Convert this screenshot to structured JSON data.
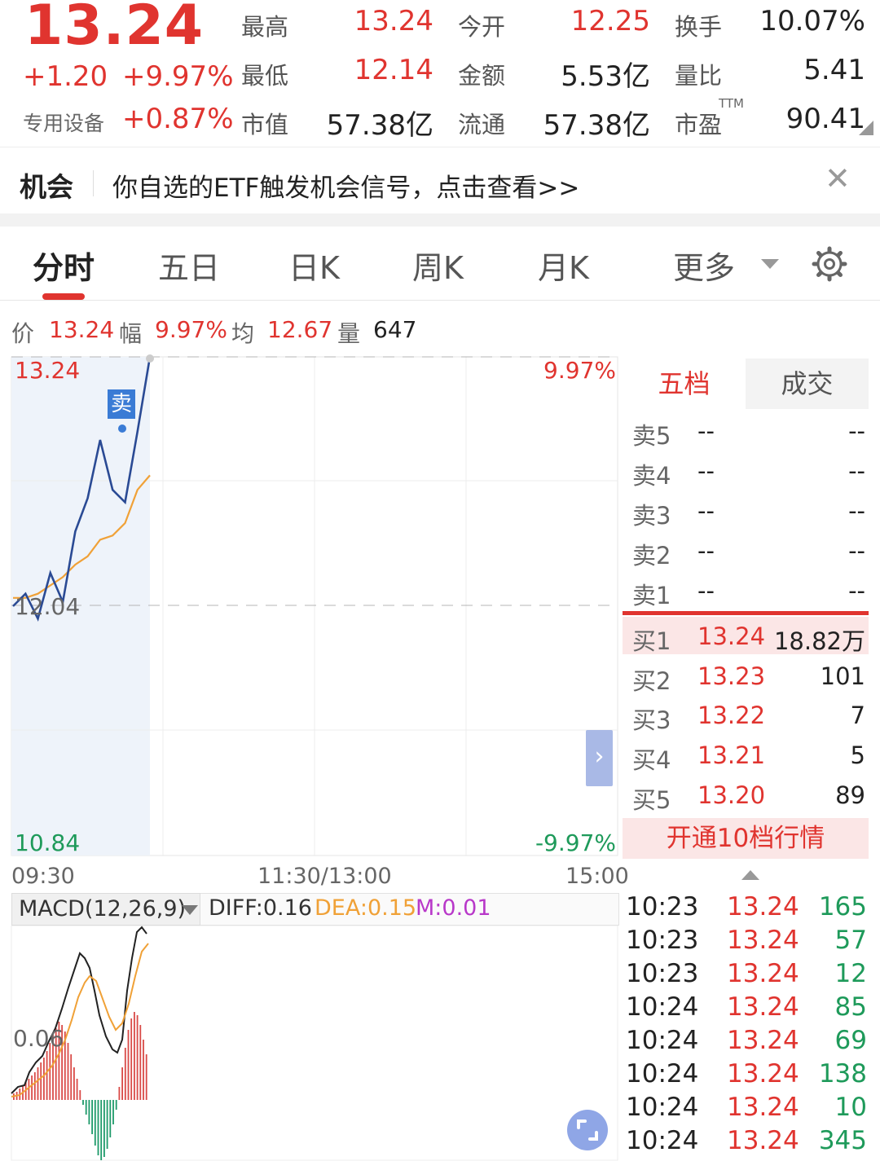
{
  "quote": {
    "price": "13.24",
    "change": "+1.20",
    "change_pct": "+9.97%",
    "sector_name": "专用设备",
    "sector_change": "+0.87%",
    "rows": [
      {
        "l1": "最高",
        "v1": "13.24",
        "l2": "今开",
        "v2": "12.25",
        "l3": "换手",
        "v3": "10.07%"
      },
      {
        "l1": "最低",
        "v1": "12.14",
        "l2": "金额",
        "v2": "5.53亿",
        "l3": "量比",
        "v3": "5.41"
      },
      {
        "l1": "市值",
        "v1": "57.38亿",
        "l2": "流通",
        "v2": "57.38亿",
        "l3": "市盈",
        "v3": "90.41"
      }
    ],
    "ttm": "TTM"
  },
  "opportunity": {
    "label": "机会",
    "text": "你自选的ETF触发机会信号，点击查看>>",
    "close_glyph": "✕"
  },
  "tabs": [
    "分时",
    "五日",
    "日K",
    "周K",
    "月K",
    "更多"
  ],
  "info": {
    "price_label": "价",
    "price": "13.24",
    "amp_label": "幅",
    "amp": "9.97%",
    "avg_label": "均",
    "avg": "12.67",
    "vol_label": "量",
    "vol": "647"
  },
  "chart": {
    "y_top": "13.24",
    "y_mid": "12.04",
    "y_bottom": "10.84",
    "pct_top": "9.97%",
    "pct_bottom": "-9.97%",
    "sell_marker": "卖",
    "times": [
      "09:30",
      "11:30/13:00",
      "15:00"
    ],
    "expand_glyph": "›"
  },
  "chart_data": {
    "type": "line",
    "series": [
      {
        "values": [
          12.04,
          12.1,
          11.98,
          12.2,
          12.06,
          12.4,
          12.56,
          12.84,
          12.6,
          12.54,
          12.88,
          13.24
        ]
      },
      {
        "values": [
          12.08,
          12.08,
          12.1,
          12.14,
          12.18,
          12.24,
          12.28,
          12.36,
          12.38,
          12.44,
          12.6,
          12.67
        ]
      }
    ],
    "ylim": [
      10.84,
      13.24
    ]
  },
  "orderbook": {
    "tab_active": "五档",
    "tab_other": "成交",
    "asks": [
      {
        "label": "卖5",
        "price": "--",
        "vol": "--"
      },
      {
        "label": "卖4",
        "price": "--",
        "vol": "--"
      },
      {
        "label": "卖3",
        "price": "--",
        "vol": "--"
      },
      {
        "label": "卖2",
        "price": "--",
        "vol": "--"
      },
      {
        "label": "卖1",
        "price": "--",
        "vol": "--"
      }
    ],
    "bids": [
      {
        "label": "买1",
        "price": "13.24",
        "vol": "18.82万"
      },
      {
        "label": "买2",
        "price": "13.23",
        "vol": "101"
      },
      {
        "label": "买3",
        "price": "13.22",
        "vol": "7"
      },
      {
        "label": "买4",
        "price": "13.21",
        "vol": "5"
      },
      {
        "label": "买5",
        "price": "13.20",
        "vol": "89"
      }
    ],
    "upgrade": "开通10档行情"
  },
  "macd": {
    "title": "MACD(12,26,9)",
    "diff": "DIFF:0.16",
    "dea": "DEA:0.15",
    "m": "M:0.01",
    "level": "0.06"
  },
  "trades": [
    {
      "time": "10:23",
      "price": "13.24",
      "vol": "165"
    },
    {
      "time": "10:23",
      "price": "13.24",
      "vol": "57"
    },
    {
      "time": "10:23",
      "price": "13.24",
      "vol": "12"
    },
    {
      "time": "10:24",
      "price": "13.24",
      "vol": "85"
    },
    {
      "time": "10:24",
      "price": "13.24",
      "vol": "69"
    },
    {
      "time": "10:24",
      "price": "13.24",
      "vol": "138"
    },
    {
      "time": "10:24",
      "price": "13.24",
      "vol": "10"
    },
    {
      "time": "10:24",
      "price": "13.24",
      "vol": "345"
    }
  ]
}
